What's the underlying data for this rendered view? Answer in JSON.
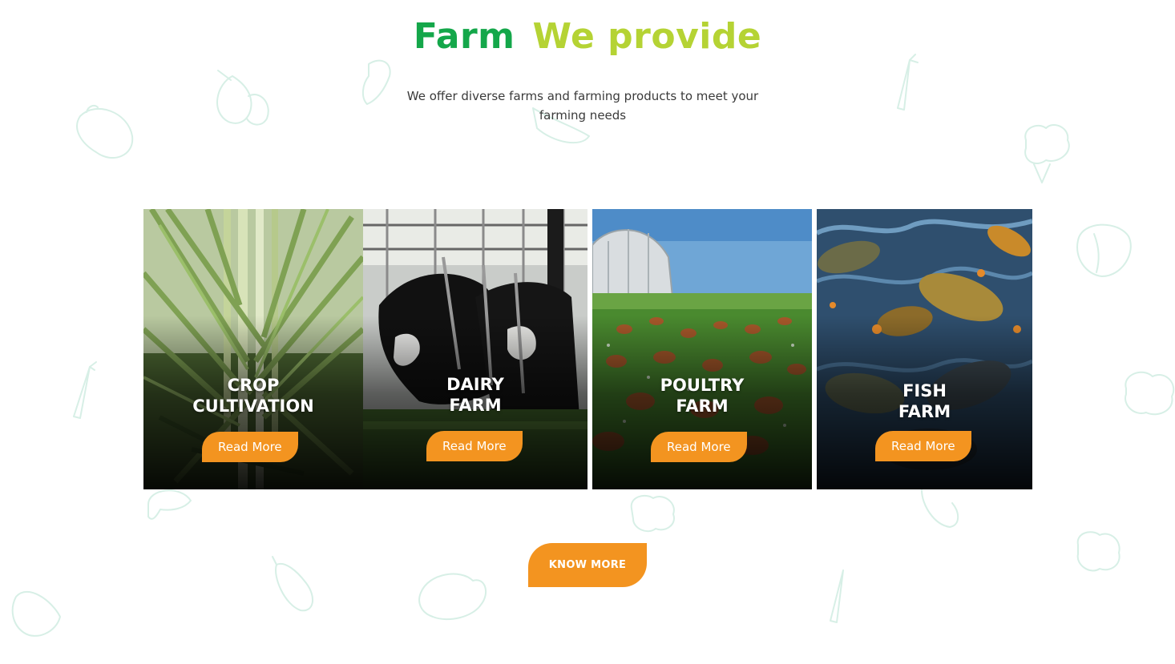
{
  "section": {
    "heading_word1": "Farm",
    "heading_word2": "We provide",
    "subtitle": "We offer diverse farms and farming products to meet your farming needs"
  },
  "cards": [
    {
      "title": "CROP\nCULTIVATION",
      "button": "Read More",
      "image": "sugarcane-crop-photo"
    },
    {
      "title": "DAIRY\nFARM",
      "button": "Read More",
      "image": "dairy-cows-photo"
    },
    {
      "title": "POULTRY\nFARM",
      "button": "Read More",
      "image": "free-range-chickens-photo"
    },
    {
      "title": "FISH\nFARM",
      "button": "Read More",
      "image": "carp-fish-pond-photo"
    }
  ],
  "cta": {
    "label": "KNOW MORE"
  },
  "colors": {
    "heading_green": "#14a74a",
    "heading_lime": "#b5d334",
    "button_orange": "#f39420",
    "doodle_mint": "#d7efe6"
  },
  "icons": [
    "vegetable-doodle-icon",
    "carrot-icon",
    "onion-icon",
    "pepper-icon",
    "cauliflower-icon",
    "eggplant-icon",
    "mushroom-icon",
    "cabbage-icon"
  ]
}
